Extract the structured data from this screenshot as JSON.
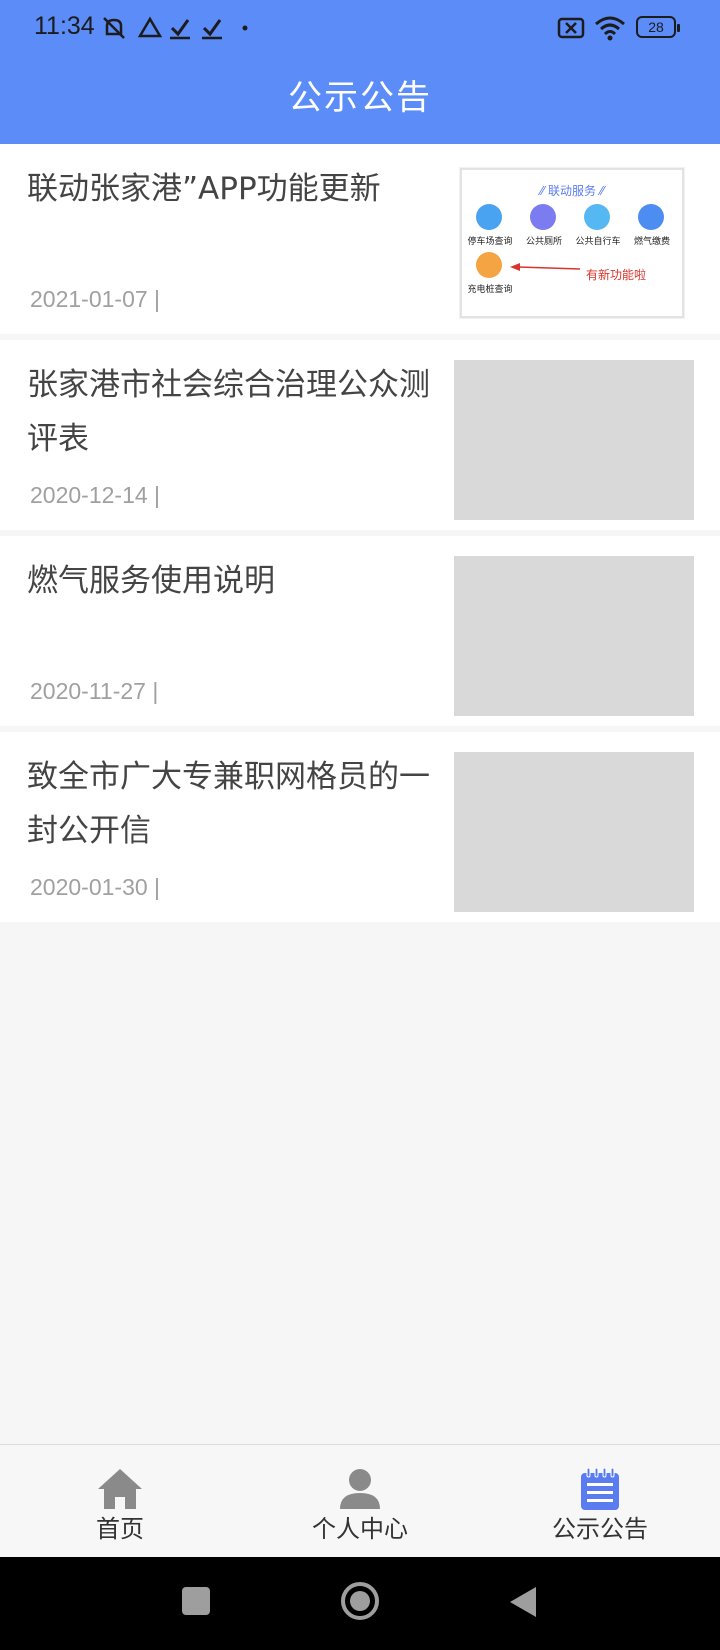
{
  "status_bar": {
    "time": "11:34",
    "battery": "28"
  },
  "header": {
    "title": "公示公告"
  },
  "articles": [
    {
      "title": "联动张家港”APP功能更新",
      "date": "2021-01-07 |",
      "thumbnail": {
        "heading": "联动服务",
        "services": [
          "停车场查询",
          "公共厕所",
          "公共自行车",
          "燃气缴费",
          "充电桩查询"
        ],
        "annotation": "有新功能啦",
        "colors": [
          "#4aa3f0",
          "#7a7cf0",
          "#55b8f2",
          "#4d8cf0",
          "#f5a443"
        ]
      }
    },
    {
      "title": "张家港市社会综合治理公众测评表",
      "date": "2020-12-14 |"
    },
    {
      "title": "燃气服务使用说明",
      "date": "2020-11-27 |"
    },
    {
      "title": "致全市广大专兼职网格员的一封公开信",
      "date": "2020-01-30 |"
    }
  ],
  "tabbar": {
    "tabs": [
      {
        "label": "首页",
        "icon": "home-icon"
      },
      {
        "label": "个人中心",
        "icon": "person-icon"
      },
      {
        "label": "公示公告",
        "icon": "notice-icon",
        "active": true
      }
    ],
    "active_color": "#5b7cf0",
    "inactive_color": "#8a8a8a"
  }
}
